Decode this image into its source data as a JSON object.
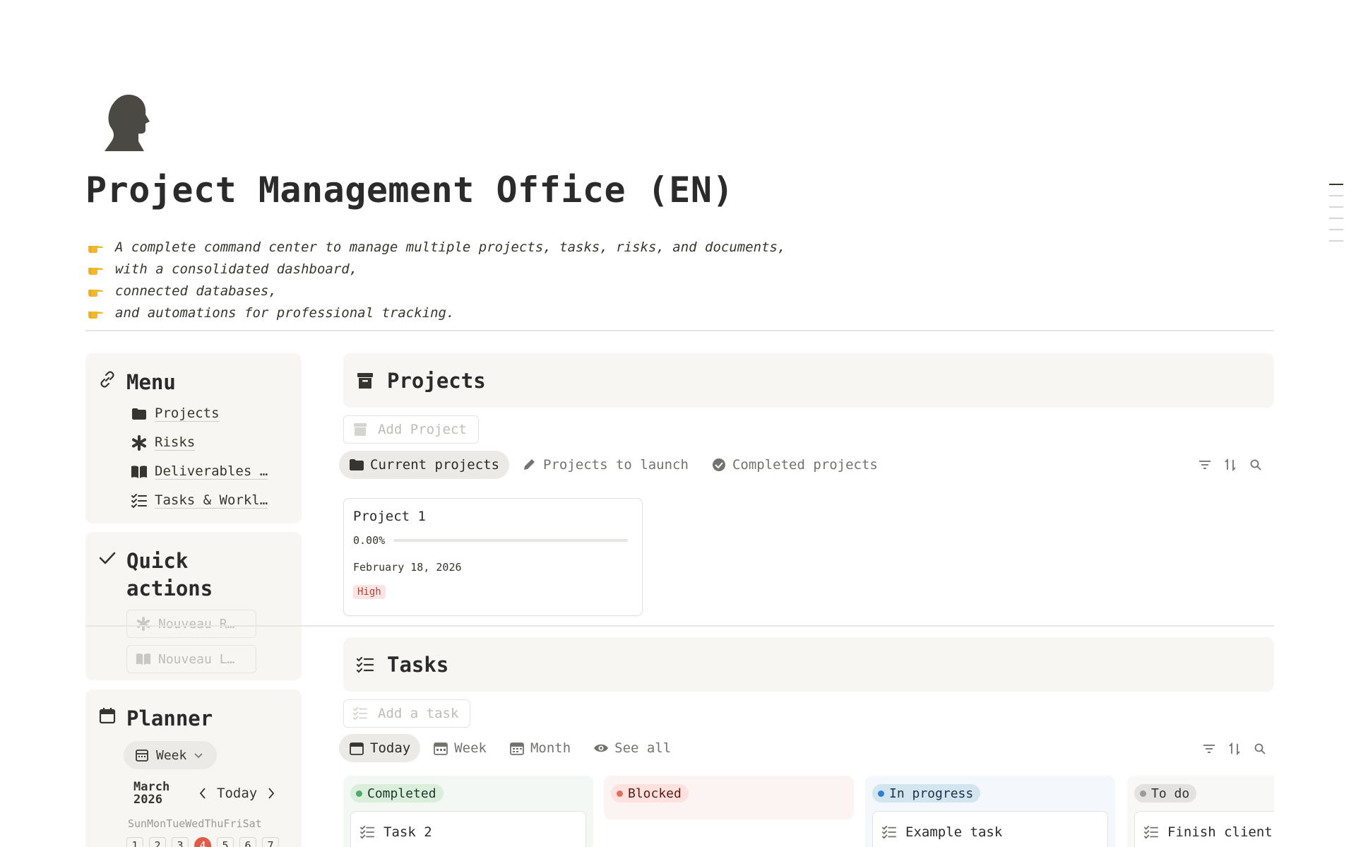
{
  "page": {
    "title": "Project Management Office (EN)",
    "description": [
      "A complete command center to manage multiple projects, tasks, risks, and documents,",
      "with a consolidated dashboard,",
      "connected databases,",
      "and automations for professional tracking."
    ],
    "icon": "head-silhouette-icon",
    "description_icon": "pointing-hand-icon"
  },
  "menu": {
    "title": "Menu",
    "items": [
      {
        "label": "Projects",
        "icon": "folder-icon"
      },
      {
        "label": "Risks",
        "icon": "asterisk-icon"
      },
      {
        "label": "Deliverables …",
        "icon": "book-icon"
      },
      {
        "label": "Tasks & Workl…",
        "icon": "checklist-icon"
      }
    ]
  },
  "quick_actions": {
    "title_line1": "Quick",
    "title_line2": "actions",
    "buttons": [
      {
        "label": "Nouveau R…",
        "icon": "asterisk-icon"
      },
      {
        "label": "Nouveau L…",
        "icon": "book-icon"
      }
    ]
  },
  "planner": {
    "title": "Planner",
    "view": "Week",
    "month": "March",
    "year": "2026",
    "today_label": "Today",
    "weekdays": [
      "Sun",
      "Mon",
      "Tue",
      "Wed",
      "Thu",
      "Fri",
      "Sat"
    ],
    "dates": [
      "1",
      "2",
      "3",
      "4",
      "5",
      "6",
      "7"
    ],
    "current_date": "4"
  },
  "projects": {
    "title": "Projects",
    "add_label": "Add Project",
    "tabs": [
      {
        "label": "Current projects",
        "icon": "folder-icon",
        "active": true
      },
      {
        "label": "Projects to launch",
        "icon": "pencil-icon",
        "active": false
      },
      {
        "label": "Completed projects",
        "icon": "check-circle-icon",
        "active": false
      }
    ],
    "cards": [
      {
        "name": "Project 1",
        "progress_label": "0.00%",
        "progress": 0.0,
        "date": "February 18, 2026",
        "priority": "High"
      }
    ]
  },
  "tasks": {
    "title": "Tasks",
    "add_label": "Add a task",
    "tabs": [
      {
        "label": "Today",
        "icon": "calendar-icon",
        "active": true
      },
      {
        "label": "Week",
        "icon": "calendar-week-icon",
        "active": false
      },
      {
        "label": "Month",
        "icon": "calendar-month-icon",
        "active": false
      },
      {
        "label": "See all",
        "icon": "eye-icon",
        "active": false
      }
    ],
    "columns": [
      {
        "status": "Completed",
        "task": "Task 2"
      },
      {
        "status": "Blocked",
        "task": ""
      },
      {
        "status": "In progress",
        "task": "Example task"
      },
      {
        "status": "To do",
        "task": "Finish client"
      }
    ]
  },
  "colors": {
    "completed_bg": "#f3f8f5",
    "completed_pill": "#dbeddb",
    "completed_dot": "#4dab6a",
    "completed_text": "#1c3829",
    "blocked_bg": "#fcf4f3",
    "blocked_pill": "#ffe2dd",
    "blocked_dot": "#e16f5f",
    "blocked_text": "#5d1715",
    "progress_bg": "#f4f8fc",
    "progress_pill": "#d3e5ef",
    "progress_dot": "#2e7fd6",
    "progress_text": "#183347",
    "todo_bg": "#f8f8f7",
    "todo_pill": "#e3e2e0",
    "todo_dot": "#9b9a97",
    "todo_text": "#32302c",
    "high_bg": "#fbe4e2",
    "high_text": "#b8423a"
  }
}
